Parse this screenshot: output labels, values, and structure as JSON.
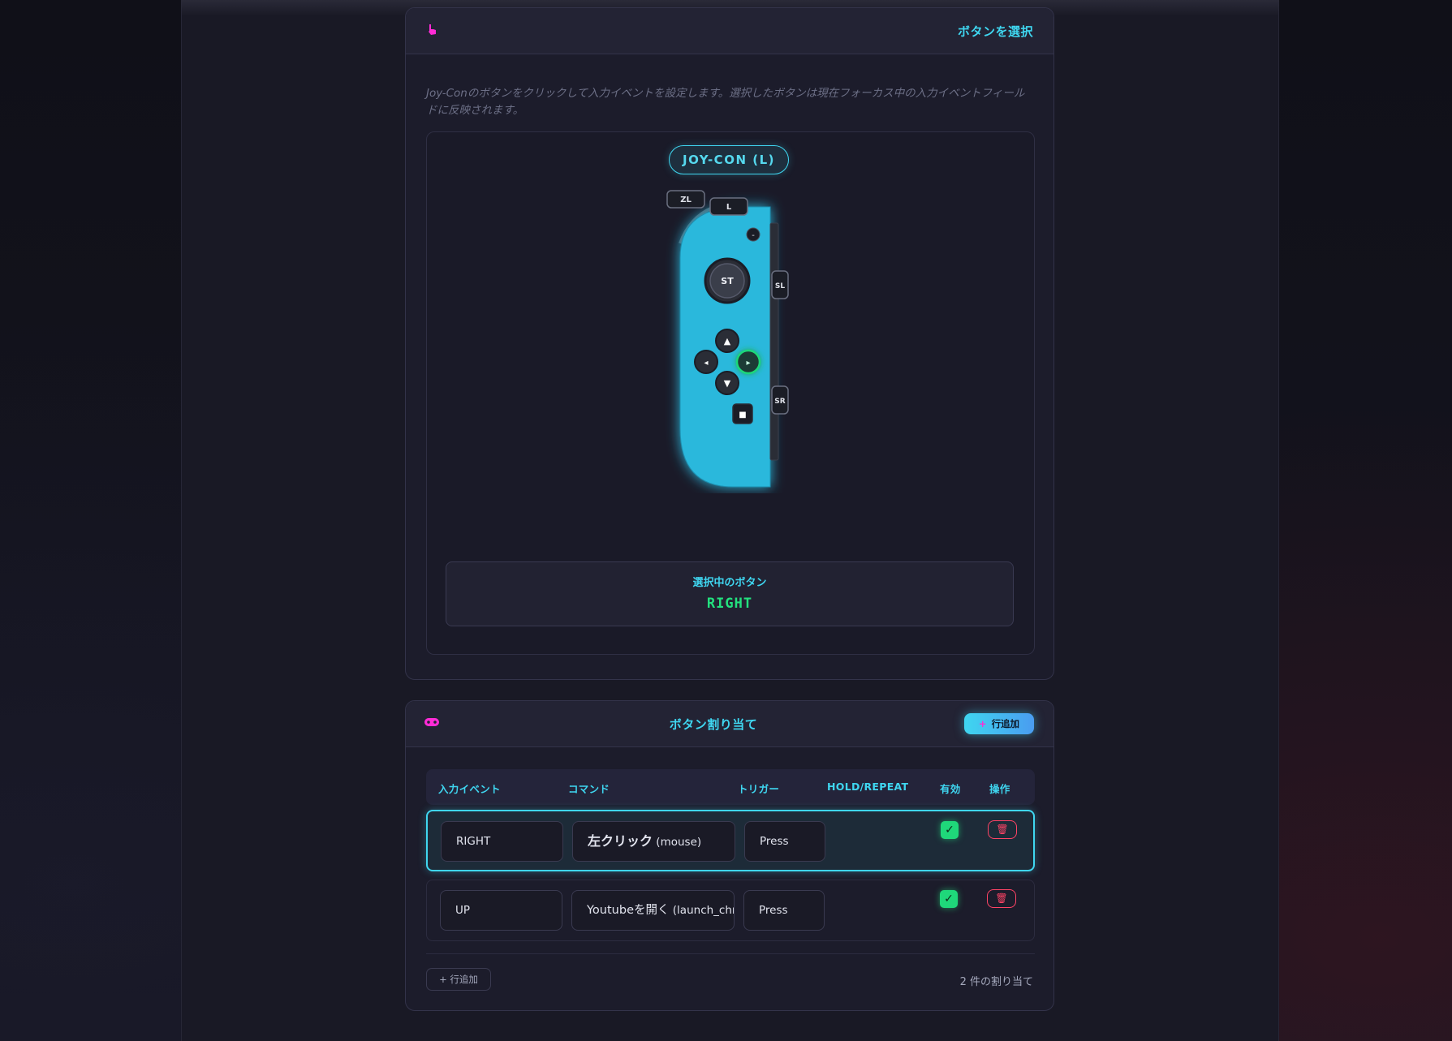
{
  "select_card": {
    "icon": "pointer-hand-icon",
    "title": "ボタンを選択",
    "description": "Joy-Conのボタンをクリックして入力イベントを設定します。選択したボタンは現在フォーカス中の入力イベントフィールドに反映されます。",
    "controller_title": "JOY-CON (L)",
    "buttons": {
      "zl": "ZL",
      "l": "L",
      "minus": "-",
      "stick": "ST",
      "sl": "SL",
      "sr": "SR",
      "up": "▲",
      "down": "▼",
      "left": "◂",
      "right": "▸",
      "capture": "■"
    },
    "selected_label": "選択中のボタン",
    "selected_value": "RIGHT"
  },
  "assign_card": {
    "icon": "gamepad-icon",
    "title": "ボタン割り当て",
    "add_row_top": "行追加",
    "columns": [
      "入力イベント",
      "コマンド",
      "トリガー",
      "HOLD/REPEAT",
      "有効",
      "操作"
    ],
    "rows": [
      {
        "event": "RIGHT",
        "command_main": "左クリック",
        "command_sub": " (mouse)",
        "trigger": "Press",
        "enabled": true
      },
      {
        "event": "UP",
        "command_main": "Youtubeを開く",
        "command_sub": " (launch_chrome)",
        "trigger": "Press",
        "enabled": true
      }
    ],
    "add_row_bottom": "行追加",
    "count_text": "2 件の割り当て"
  },
  "colors": {
    "accent_cyan": "#3fd6f0",
    "accent_magenta": "#ff2bd6",
    "success_green": "#1fd87a",
    "danger_red": "#ff4466",
    "joycon_blue": "#2bb8dc"
  }
}
